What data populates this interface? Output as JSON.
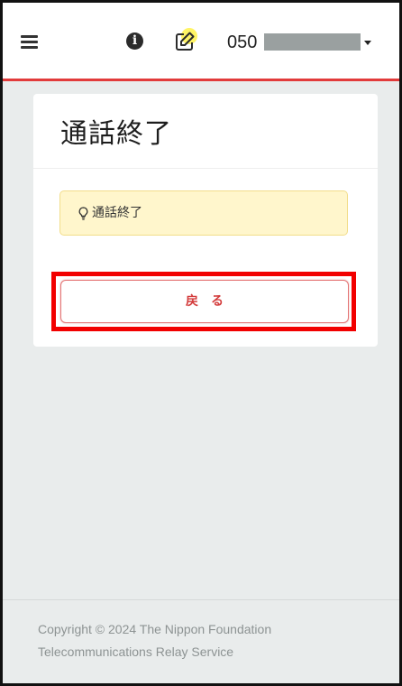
{
  "navbar": {
    "menu_icon": "hamburger-menu-icon",
    "info_icon": "info-circle-icon",
    "info_glyph": "i",
    "edit_icon": "edit-pencil-icon",
    "phone_prefix": "050",
    "dropdown_icon": "caret-down-icon",
    "accent_color": "#e23b3b"
  },
  "card": {
    "title": "通話終了",
    "alert": {
      "icon": "lightbulb-icon",
      "text": "通話終了",
      "bg_color": "#fff6cc"
    },
    "back_button_label": "戻る",
    "highlight_color": "#f20000"
  },
  "footer": {
    "line1": "Copyright © 2024 The Nippon Foundation",
    "line2": "Telecommunications Relay Service"
  }
}
